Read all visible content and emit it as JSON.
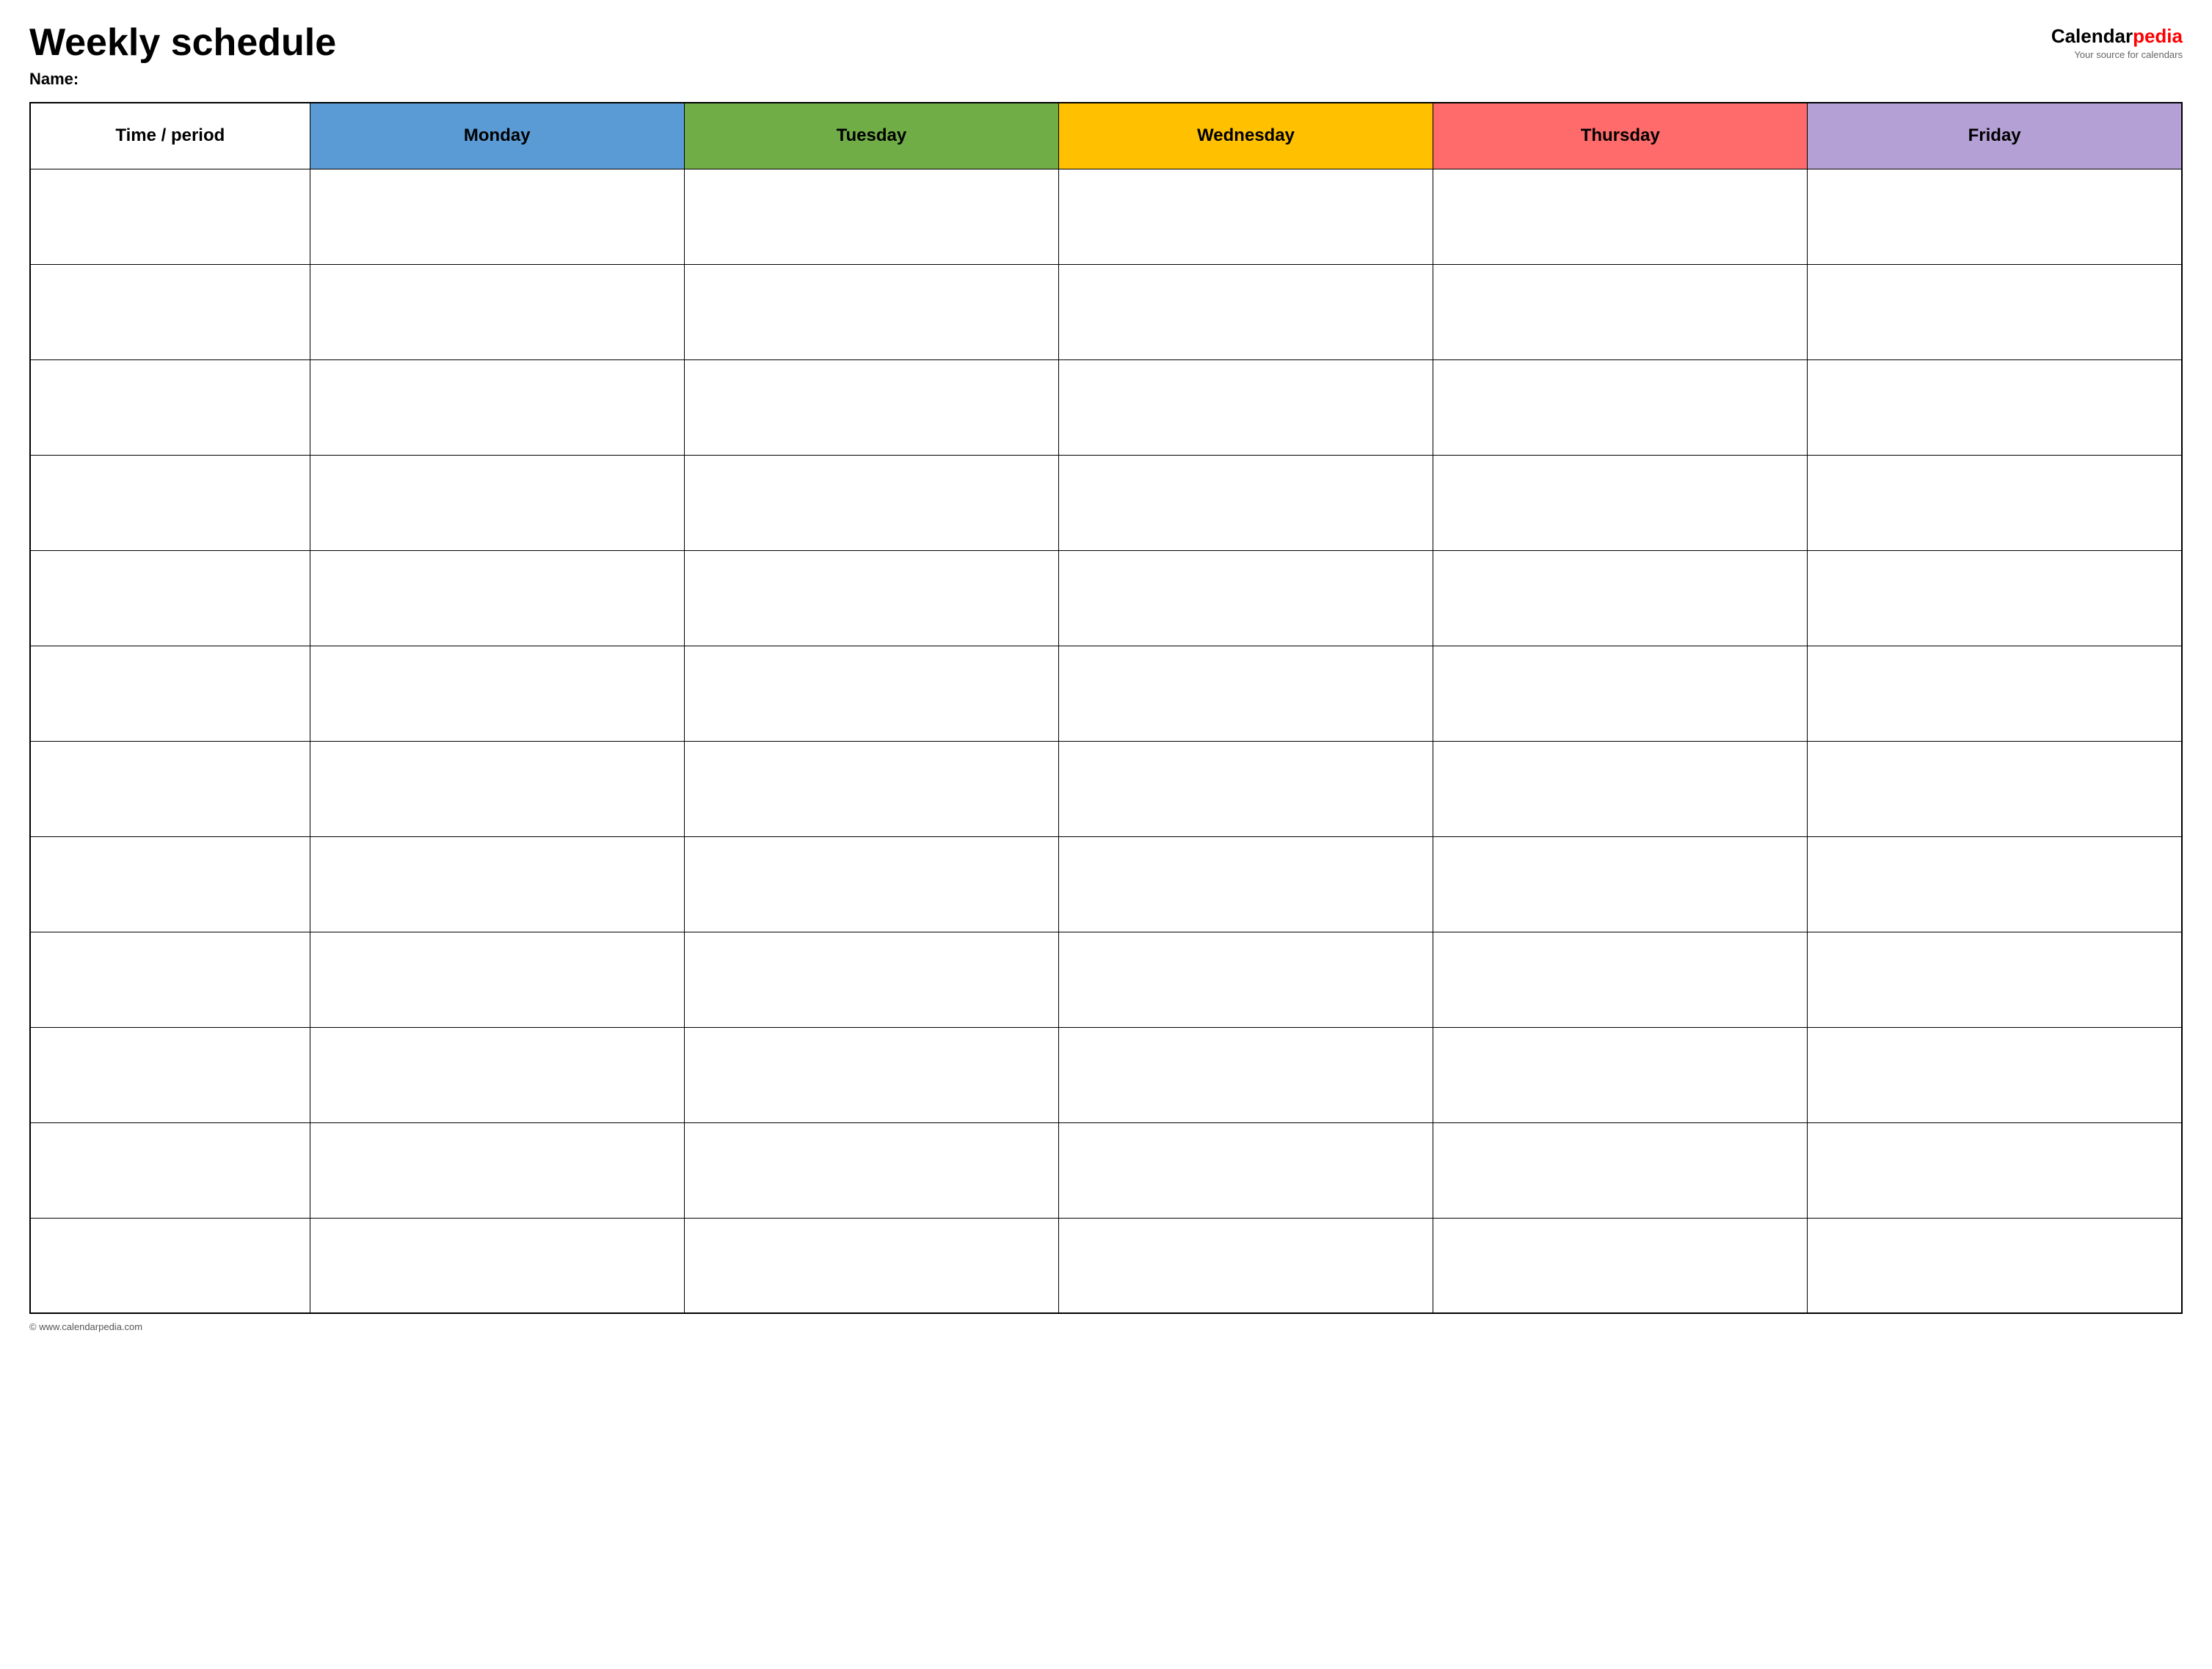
{
  "header": {
    "title": "Weekly schedule",
    "name_label": "Name:",
    "logo": {
      "calendar_text": "Calendar",
      "pedia_text": "pedia",
      "tagline": "Your source for calendars"
    }
  },
  "table": {
    "columns": [
      {
        "id": "time",
        "label": "Time / period",
        "color": "#ffffff"
      },
      {
        "id": "monday",
        "label": "Monday",
        "color": "#5b9bd5"
      },
      {
        "id": "tuesday",
        "label": "Tuesday",
        "color": "#70ad47"
      },
      {
        "id": "wednesday",
        "label": "Wednesday",
        "color": "#ffc000"
      },
      {
        "id": "thursday",
        "label": "Thursday",
        "color": "#ff6b6b"
      },
      {
        "id": "friday",
        "label": "Friday",
        "color": "#b4a0d4"
      }
    ],
    "rows": 12
  },
  "footer": {
    "text": "© www.calendarpedia.com"
  }
}
